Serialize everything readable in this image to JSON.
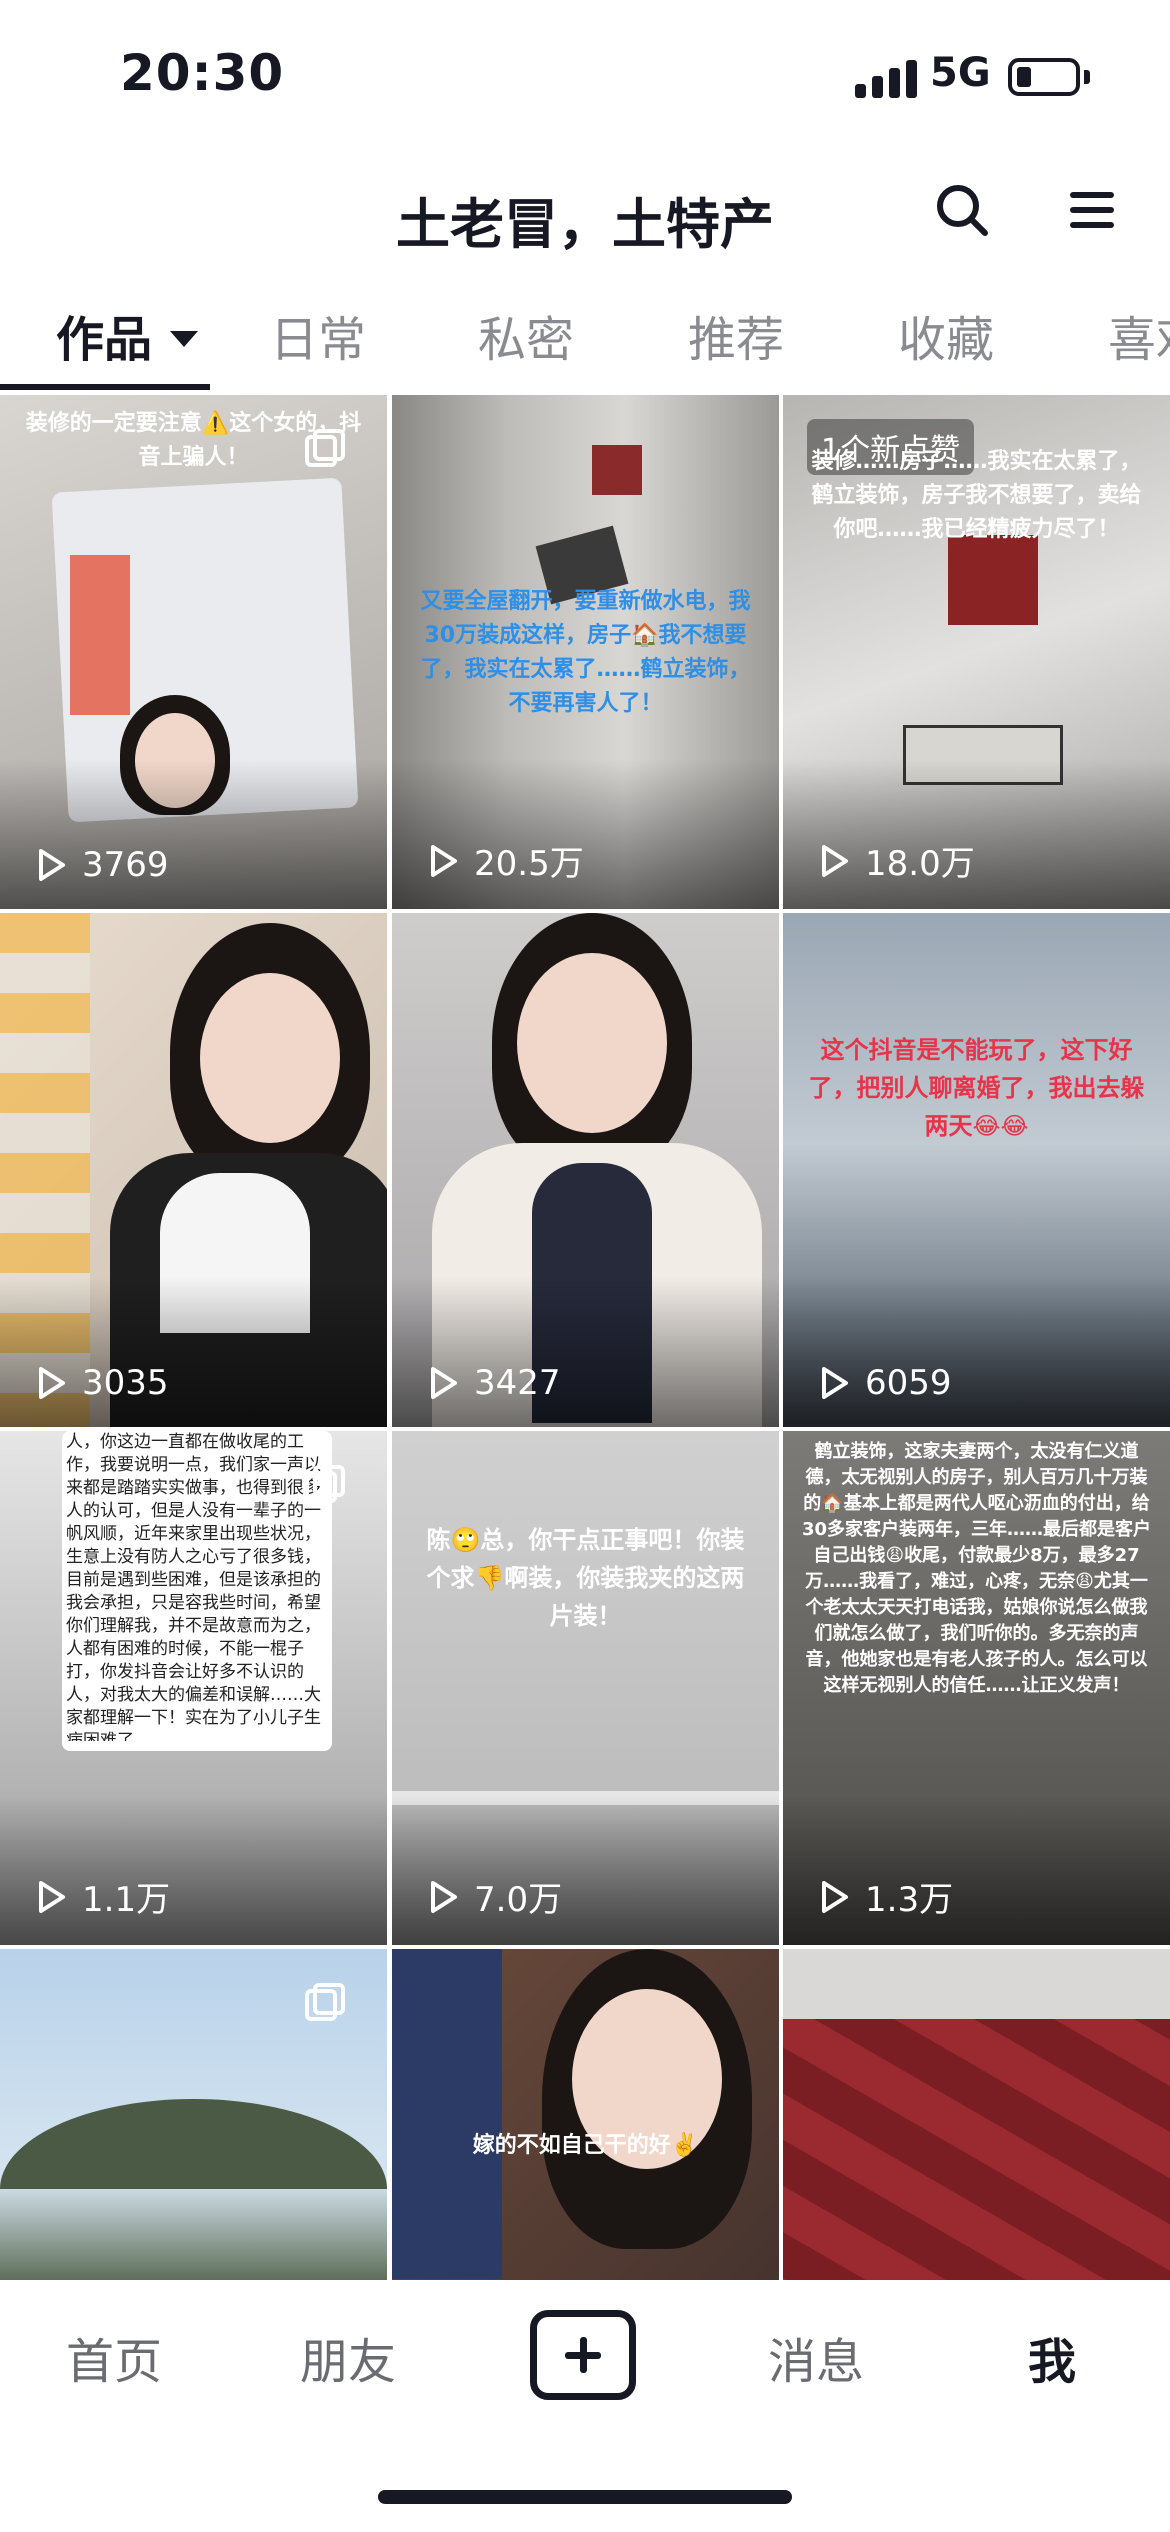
{
  "status_bar": {
    "time": "20:30",
    "network": "5G"
  },
  "header": {
    "title": "土老冒，土特产"
  },
  "tabs": [
    {
      "label": "作品"
    },
    {
      "label": "日常"
    },
    {
      "label": "私密"
    },
    {
      "label": "推荐"
    },
    {
      "label": "收藏"
    },
    {
      "label": "喜欢"
    }
  ],
  "videos": [
    {
      "count": "3769",
      "caption": "装修的一定要注意⚠️这个女的，抖音上骗人！",
      "multi": true
    },
    {
      "count": "20.5万",
      "caption": "又要全屋翻开，要重新做水电，我30万装成这样，房子🏠我不想要了，我实在太累了……鹤立装饰，不要再害人了！"
    },
    {
      "count": "18.0万",
      "badge": "1个新点赞",
      "caption": "装修……房子……我实在太累了，鹤立装饰，房子我不想要了，卖给你吧……我已经精疲力尽了！"
    },
    {
      "count": "3035"
    },
    {
      "count": "3427"
    },
    {
      "count": "6059",
      "caption": "这个抖音是不能玩了，这下好了，把别人聊离婚了，我出去躲两天😂😂"
    },
    {
      "count": "1.1万",
      "caption": "人，你这边一直都在做收尾的工作，我要说明一点，我们家一声以来都是踏踏实实做事，也得到很多人的认可，但是人没有一辈子的一帆风顺，近年来家里出现些状况，生意上没有防人之心亏了很多钱，目前是遇到些困难，但是该承担的我会承担，只是容我些时间，希望你们理解我，并不是故意而为之，人都有困难的时候，不能一棍子打，你发抖音会让好多不认识的人，对我太大的偏差和误解……大家都理解一下！实在为了小儿子生病困难了……",
      "multi": true
    },
    {
      "count": "7.0万",
      "caption": "陈🙄总，你干点正事吧！你装个求👎啊装，你装我夹的这两片装！"
    },
    {
      "count": "1.3万",
      "caption": "鹤立装饰，这家夫妻两个，太没有仁义道德，太无视别人的房子，别人百万几十万装的🏠基本上都是两代人呕心沥血的付出，给30多家客户装两年，三年……最后都是客户自己出钱😩收尾，付款最少8万，最多27万……我看了，难过，心疼，无奈😩尤其一个老太太天天打电话我，姑娘你说怎么做我们就怎么做了，我们听你的。多无奈的声音，他她家也是有老人孩子的人。怎么可以这样无视别人的信任……让正义发声！"
    },
    {
      "count": "",
      "multi": true
    },
    {
      "count": "",
      "caption": "嫁的不如自己干的好✌️"
    },
    {
      "count": ""
    }
  ],
  "bottom_nav": {
    "home": "首页",
    "friends": "朋友",
    "messages": "消息",
    "me": "我"
  },
  "icons": {
    "search": "search-icon",
    "menu": "menu-icon",
    "play": "play-icon",
    "multi": "multi-image-icon",
    "plus": "plus-icon"
  },
  "colors": {
    "text": "#161823",
    "muted": "#8a8b91",
    "caption_blue": "#2f8fe6",
    "caption_red": "#e8344a"
  }
}
